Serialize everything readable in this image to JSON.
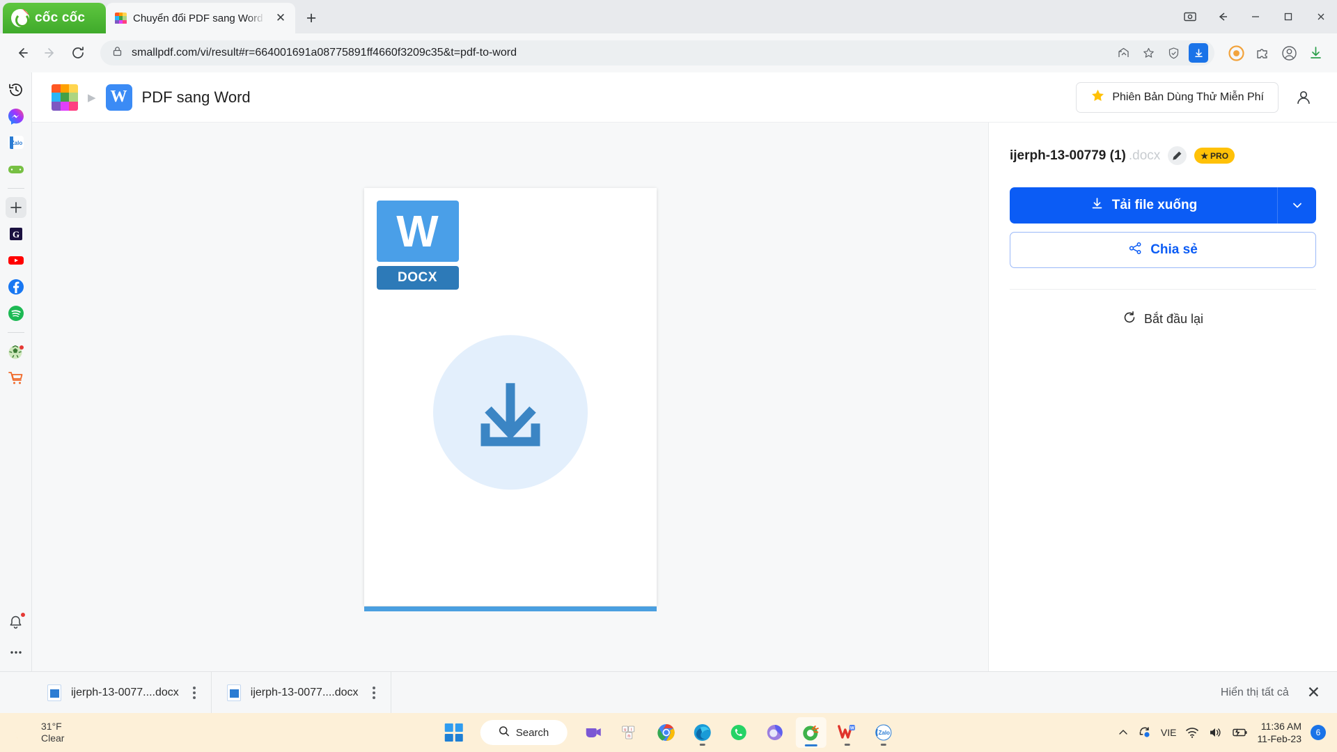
{
  "browser": {
    "brand": "cốc cốc",
    "tab": {
      "title": "Chuyển đổi PDF sang Word",
      "close_label": "✕"
    },
    "new_tab_label": "+",
    "url": "smallpdf.com/vi/result#r=664001691a08775891ff4660f3209c35&t=pdf-to-word",
    "window_controls": {
      "minimize": "─",
      "maximize": "☐",
      "close": "✕"
    }
  },
  "sidebar": {
    "items": [
      {
        "name": "history-icon",
        "glyph": "↺"
      },
      {
        "name": "messenger-icon",
        "glyph": ""
      },
      {
        "name": "zalo-icon",
        "glyph": "Zalo"
      },
      {
        "name": "games-icon",
        "glyph": ""
      },
      {
        "name": "add-icon",
        "glyph": "+"
      },
      {
        "name": "g-icon",
        "glyph": "G"
      },
      {
        "name": "youtube-icon",
        "glyph": ""
      },
      {
        "name": "facebook-icon",
        "glyph": "f"
      },
      {
        "name": "spotify-icon",
        "glyph": ""
      },
      {
        "name": "football-icon",
        "glyph": ""
      },
      {
        "name": "shopping-icon",
        "glyph": ""
      }
    ],
    "bell_icon": "🔔",
    "more_icon": "⋯"
  },
  "page_header": {
    "breadcrumb_arrow": "▶",
    "tool_badge_letter": "W",
    "tool_name": "PDF sang Word",
    "trial_button": "Phiên Bản Dùng Thử Miễn Phí",
    "trial_star": "★"
  },
  "preview": {
    "word_letter": "W",
    "extension_label": "DOCX"
  },
  "result": {
    "file_name": "ijerph-13-00779 (1)",
    "file_ext": ".docx",
    "pro_badge": "PRO",
    "pro_star": "★",
    "download_label": "Tải file xuống",
    "share_label": "Chia sẻ",
    "restart_label": "Bắt đầu lại"
  },
  "download_shelf": {
    "items": [
      {
        "name": "ijerph-13-0077....docx"
      },
      {
        "name": "ijerph-13-0077....docx"
      }
    ],
    "show_all": "Hiển thị tất cả",
    "close": "✕"
  },
  "taskbar": {
    "weather": {
      "temp": "31°F",
      "condition": "Clear"
    },
    "search_placeholder": "Search",
    "apps": [
      {
        "name": "teams-icon"
      },
      {
        "name": "unikey-icon"
      },
      {
        "name": "chrome-icon"
      },
      {
        "name": "edge-icon"
      },
      {
        "name": "whatsapp-icon"
      },
      {
        "name": "microsoft365-icon"
      },
      {
        "name": "coccoc-icon"
      },
      {
        "name": "wps-office-icon"
      },
      {
        "name": "zalo-icon"
      }
    ],
    "tray": {
      "chevron": "⌃",
      "language": "VIE",
      "time": "11:36 AM",
      "date": "11-Feb-23",
      "badge_count": "6"
    }
  },
  "colors": {
    "accent_blue": "#0b5cf5",
    "word_blue": "#4a9fe8",
    "pro_gold": "#ffc107",
    "coccoc_green": "#4caf2b",
    "taskbar_bg": "#fdf0d8"
  }
}
